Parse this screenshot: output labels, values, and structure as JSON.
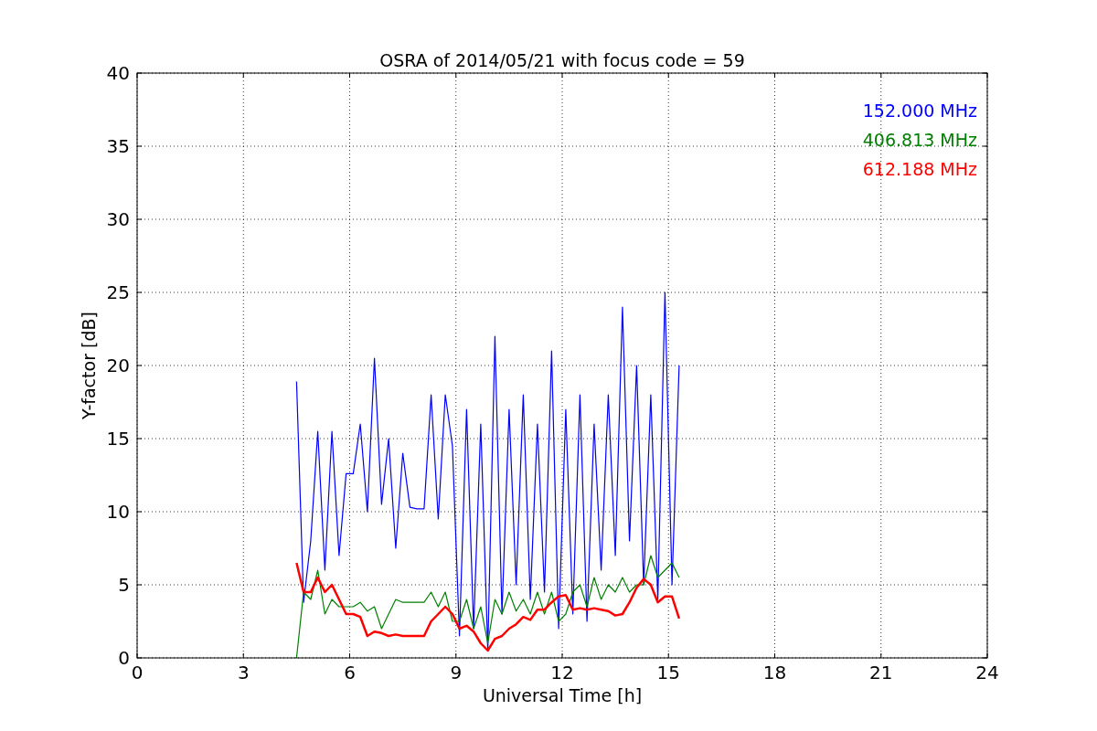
{
  "chart_data": {
    "type": "line",
    "grid": true,
    "title": "OSRA of 2014/05/21 with focus code = 59",
    "xlabel": "Universal Time [h]",
    "ylabel": "Y-factor [dB]",
    "xlim": [
      0,
      24
    ],
    "ylim": [
      0,
      40
    ],
    "xticks": [
      0,
      3,
      6,
      9,
      12,
      15,
      18,
      21,
      24
    ],
    "yticks": [
      0,
      5,
      10,
      15,
      20,
      25,
      30,
      35,
      40
    ],
    "x": [
      4.5,
      4.7,
      4.9,
      5.1,
      5.3,
      5.5,
      5.7,
      5.9,
      6.1,
      6.3,
      6.5,
      6.7,
      6.9,
      7.1,
      7.3,
      7.5,
      7.7,
      7.9,
      8.1,
      8.3,
      8.5,
      8.7,
      8.9,
      9.1,
      9.3,
      9.5,
      9.7,
      9.9,
      10.1,
      10.3,
      10.5,
      10.7,
      10.9,
      11.1,
      11.3,
      11.5,
      11.7,
      11.9,
      12.1,
      12.3,
      12.5,
      12.7,
      12.9,
      13.1,
      13.3,
      13.5,
      13.7,
      13.9,
      14.1,
      14.3,
      14.5,
      14.7,
      14.9,
      15.1,
      15.3
    ],
    "series": [
      {
        "name": "152.000 MHz",
        "color": "#0000ff",
        "values": [
          18.9,
          3.8,
          8,
          15.5,
          6,
          15.5,
          7,
          12.6,
          12.6,
          16,
          10,
          20.5,
          10.5,
          15,
          7.5,
          14,
          10.3,
          10.2,
          10.2,
          18,
          9.5,
          18,
          14.5,
          1.5,
          17,
          2,
          16,
          0.5,
          22,
          3,
          17,
          5,
          18,
          4,
          16,
          4.5,
          21,
          2,
          17,
          3,
          18,
          2.5,
          16,
          6,
          18,
          7,
          24,
          8,
          20,
          5,
          18,
          4,
          25,
          5,
          20
        ]
      },
      {
        "name": "406.813 MHz",
        "color": "#008000",
        "values": [
          0,
          4.5,
          4,
          6,
          3,
          4,
          3.5,
          3.5,
          3.5,
          3.8,
          3.2,
          3.5,
          2,
          3,
          4,
          3.8,
          3.8,
          3.8,
          3.8,
          4.5,
          3.5,
          4.5,
          2.5,
          2.5,
          4,
          2,
          3.5,
          1,
          4,
          3,
          4.5,
          3.2,
          4,
          3,
          4.5,
          3,
          4.5,
          2.5,
          3,
          4.5,
          5,
          3.5,
          5.5,
          4,
          5,
          4.5,
          5.5,
          4.5,
          5,
          5,
          7,
          5.5,
          6,
          6.5,
          5.5
        ]
      },
      {
        "name": "612.188 MHz",
        "color": "#ff0000",
        "values": [
          6.5,
          4.5,
          4.5,
          5.5,
          4.5,
          5,
          4,
          3,
          3,
          2.8,
          1.5,
          1.8,
          1.7,
          1.5,
          1.6,
          1.5,
          1.5,
          1.5,
          1.5,
          2.5,
          3,
          3.5,
          3,
          2,
          2.2,
          1.8,
          1,
          0.5,
          1.3,
          1.5,
          2,
          2.3,
          2.8,
          2.6,
          3.3,
          3.3,
          3.8,
          4.2,
          4.3,
          3.3,
          3.4,
          3.3,
          3.4,
          3.3,
          3.2,
          2.9,
          3,
          3.8,
          4.8,
          5.4,
          5,
          3.8,
          4.2,
          4.2,
          2.7
        ]
      }
    ]
  }
}
